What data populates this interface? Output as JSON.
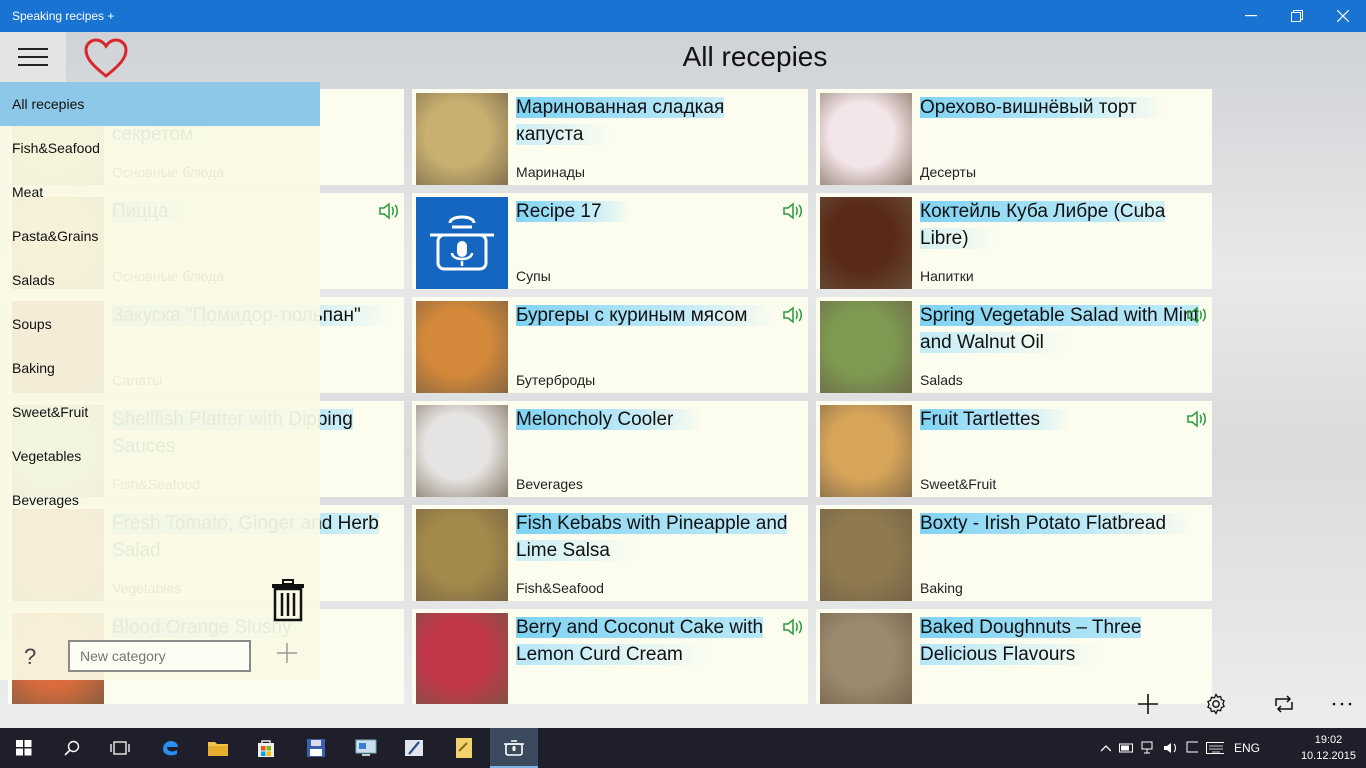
{
  "window": {
    "title": "Speaking recipes +"
  },
  "header": {
    "title": "All recepies"
  },
  "sidebar": {
    "items": [
      {
        "label": "All recepies",
        "selected": true
      },
      {
        "label": "Fish&Seafood"
      },
      {
        "label": "Meat"
      },
      {
        "label": "Pasta&Grains"
      },
      {
        "label": "Salads"
      },
      {
        "label": "Soups"
      },
      {
        "label": "Baking"
      },
      {
        "label": "Sweet&Fruit"
      },
      {
        "label": "Vegetables"
      },
      {
        "label": "Beverages"
      }
    ],
    "help_label": "?",
    "new_category_placeholder": "New category"
  },
  "recipes": [
    {
      "title": "Котлеты в духовке, с секретом",
      "category": "Основные блюда",
      "speaking": false,
      "thumb": "#c9a26a"
    },
    {
      "title": "Маринованная сладкая капуста",
      "category": "Маринады",
      "speaking": false,
      "thumb": "#c8b070"
    },
    {
      "title": "Орехово-вишнёвый торт",
      "category": "Десерты",
      "speaking": false,
      "thumb": "#f3e5e8"
    },
    {
      "title": "Пицца",
      "category": "Основные блюда",
      "speaking": true,
      "thumb": "#c97a3c"
    },
    {
      "title": "Recipe 17",
      "category": "Супы",
      "speaking": true,
      "thumb": "#1466c0",
      "placeholder": true
    },
    {
      "title": "Коктейль Куба Либре (Cuba Libre)",
      "category": "Напитки",
      "speaking": false,
      "thumb": "#5a2a18"
    },
    {
      "title": "Закуска \"Помидор-тюльпан\"",
      "category": "Салаты",
      "speaking": false,
      "thumb": "#b93a2a"
    },
    {
      "title": "Бургеры с куриным мясом",
      "category": "Бутерброды",
      "speaking": true,
      "thumb": "#d4893a"
    },
    {
      "title": "Spring Vegetable Salad with Mint and Walnut Oil",
      "category": "Salads",
      "speaking": true,
      "thumb": "#7d9a52"
    },
    {
      "title": "Shellfish Platter with Dipping Sauces",
      "category": "Fish&Seafood",
      "speaking": false,
      "thumb": "#a9b89a"
    },
    {
      "title": "Meloncholy Cooler",
      "category": "Beverages",
      "speaking": false,
      "thumb": "#e6e4e2"
    },
    {
      "title": "Fruit Tartlettes",
      "category": "Sweet&Fruit",
      "speaking": true,
      "thumb": "#d7a55a"
    },
    {
      "title": "Fresh Tomato, Ginger and Herb Salad",
      "category": "Vegetables",
      "speaking": false,
      "thumb": "#c2453a"
    },
    {
      "title": "Fish Kebabs with Pineapple and Lime Salsa",
      "category": "Fish&Seafood",
      "speaking": false,
      "thumb": "#a48a4a"
    },
    {
      "title": "Boxty - Irish Potato Flatbread",
      "category": "Baking",
      "speaking": false,
      "thumb": "#8f7a4e"
    },
    {
      "title": "Blood Orange Slushy",
      "category": "",
      "speaking": false,
      "thumb": "#d96b3c"
    },
    {
      "title": "Berry and Coconut Cake with Lemon Curd Cream",
      "category": "",
      "speaking": true,
      "thumb": "#c2384a"
    },
    {
      "title": "Baked Doughnuts – Three Delicious Flavours",
      "category": "",
      "speaking": false,
      "thumb": "#9a8a6e"
    }
  ],
  "taskbar": {
    "language": "ENG",
    "time": "19:02",
    "date": "10.12.2015"
  },
  "colors": {
    "accent": "#1873d3",
    "card_bg": "#fdfdef",
    "title_highlight": "#7fd3f3",
    "speaker": "#2b9a3a",
    "heart": "#d9262c"
  }
}
